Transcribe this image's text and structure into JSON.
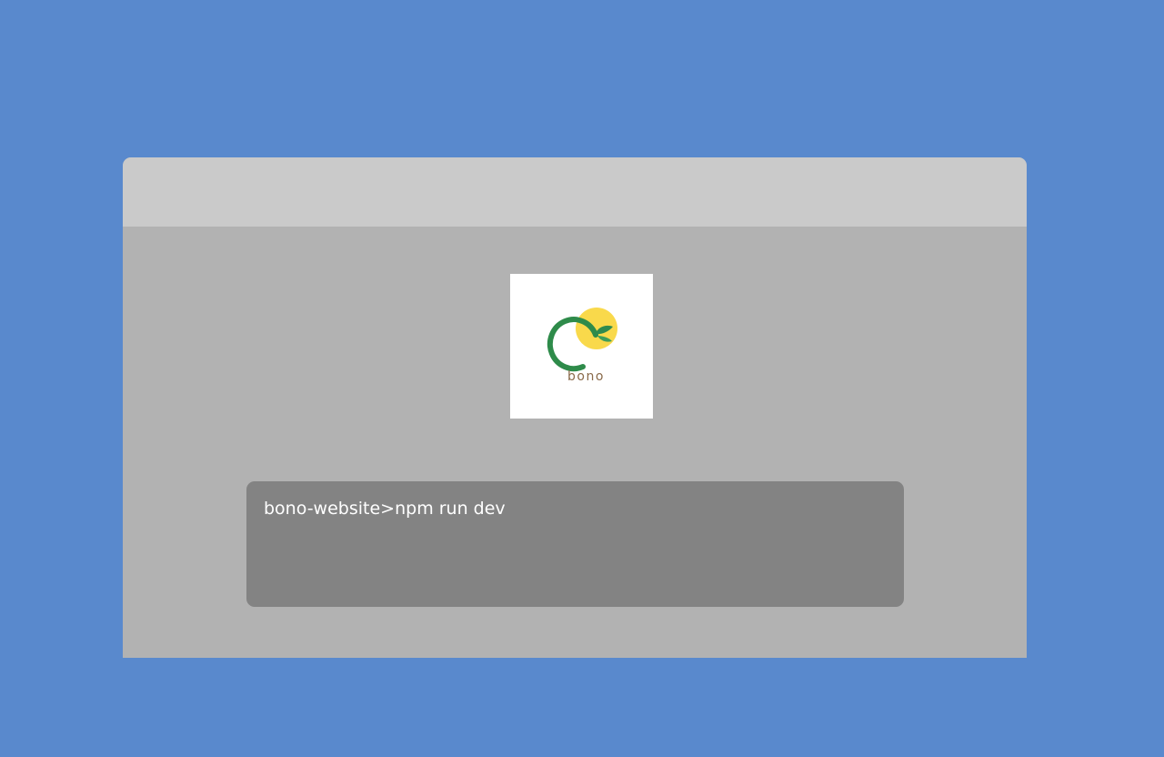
{
  "background_color": "#5989cd",
  "window": {
    "titlebar_color": "#cacaca",
    "content_color": "#b2b2b2"
  },
  "logo": {
    "text": "bono",
    "sun_color": "#f9d94b",
    "ring_color": "#2e8b4a",
    "leaf_color": "#2f8a4e",
    "text_color": "#8a6a4a"
  },
  "terminal": {
    "background_color": "#838383",
    "command_line": "bono-website>npm run dev"
  }
}
